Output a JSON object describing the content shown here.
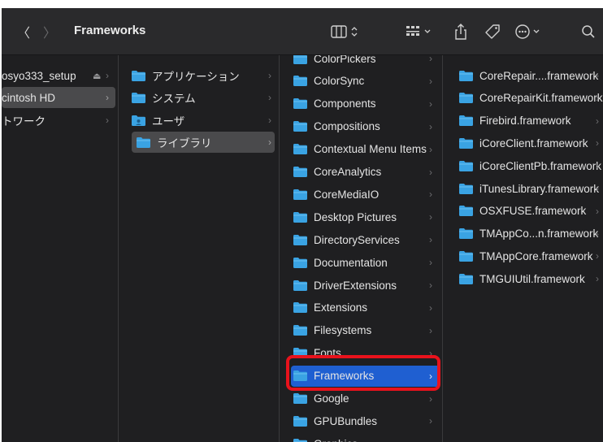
{
  "toolbar": {
    "title": "Frameworks",
    "back_label": "〈",
    "forward_label": "〉",
    "view_label": "◫ ⌃",
    "group_label": "☷ ⌄",
    "share_label": "⇪",
    "tag_label": "◇",
    "more_label": "⊙ ⌄",
    "search_label": "⌕"
  },
  "sidebar": {
    "items": [
      {
        "label": "osyo333_setup",
        "eject": "⏏"
      },
      {
        "label": "cintosh HD"
      },
      {
        "label": "トワーク"
      }
    ]
  },
  "top_column": {
    "items": [
      {
        "label": "アプリケーション"
      },
      {
        "label": "システム"
      },
      {
        "label": "ユーザ"
      },
      {
        "label": "ライブラリ"
      }
    ]
  },
  "library_column": {
    "items": [
      {
        "label": "ColorPickers"
      },
      {
        "label": "ColorSync"
      },
      {
        "label": "Components"
      },
      {
        "label": "Compositions"
      },
      {
        "label": "Contextual Menu Items"
      },
      {
        "label": "CoreAnalytics"
      },
      {
        "label": "CoreMediaIO"
      },
      {
        "label": "Desktop Pictures"
      },
      {
        "label": "DirectoryServices"
      },
      {
        "label": "Documentation"
      },
      {
        "label": "DriverExtensions"
      },
      {
        "label": "Extensions"
      },
      {
        "label": "Filesystems"
      },
      {
        "label": "Fonts"
      },
      {
        "label": "Frameworks"
      },
      {
        "label": "Google"
      },
      {
        "label": "GPUBundles"
      },
      {
        "label": "Graphics"
      }
    ]
  },
  "frameworks_column": {
    "items": [
      {
        "label": "CoreRepair....framework"
      },
      {
        "label": "CoreRepairKit.framework"
      },
      {
        "label": "Firebird.framework"
      },
      {
        "label": "iCoreClient.framework"
      },
      {
        "label": "iCoreClientPb.framework"
      },
      {
        "label": "iTunesLibrary.framework"
      },
      {
        "label": "OSXFUSE.framework"
      },
      {
        "label": "TMAppCo...n.framework"
      },
      {
        "label": "TMAppCore.framework"
      },
      {
        "label": "TMGUIUtil.framework"
      }
    ]
  },
  "chevron_glyph": "›",
  "colors": {
    "folder": "#3aa3e3",
    "selection_blue": "#1f5fd1",
    "selection_gray": "#4a4a4c",
    "highlight_border": "#e8121c"
  }
}
